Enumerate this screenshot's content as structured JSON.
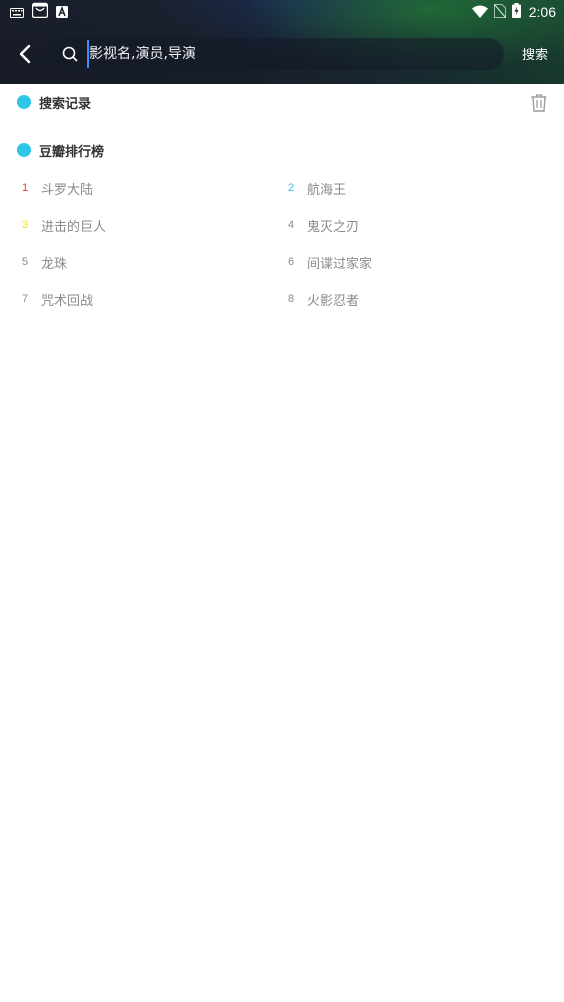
{
  "status_bar": {
    "time": "2:06",
    "left_icons": [
      "keyboard-icon",
      "store-icon",
      "text-a-icon"
    ],
    "right_icons": [
      "wifi-icon",
      "no-sim-icon",
      "battery-charging-icon"
    ]
  },
  "toolbar": {
    "search_placeholder": "影视名,演员,导演",
    "search_action": "搜索"
  },
  "history": {
    "title": "搜索记录"
  },
  "ranking": {
    "title": "豆瓣排行榜",
    "items": [
      {
        "rank": "1",
        "name": "斗罗大陆",
        "color": "#e53935"
      },
      {
        "rank": "2",
        "name": "航海王",
        "color": "#2ec5e6"
      },
      {
        "rank": "3",
        "name": "进击的巨人",
        "color": "#f5e11b"
      },
      {
        "rank": "4",
        "name": "鬼灭之刃",
        "color": "#8a8a8a"
      },
      {
        "rank": "5",
        "name": "龙珠",
        "color": "#8a8a8a"
      },
      {
        "rank": "6",
        "name": "间谍过家家",
        "color": "#8a8a8a"
      },
      {
        "rank": "7",
        "name": "咒术回战",
        "color": "#8a8a8a"
      },
      {
        "rank": "8",
        "name": "火影忍者",
        "color": "#8a8a8a"
      }
    ]
  },
  "colors": {
    "accent": "#2ec5e6"
  }
}
